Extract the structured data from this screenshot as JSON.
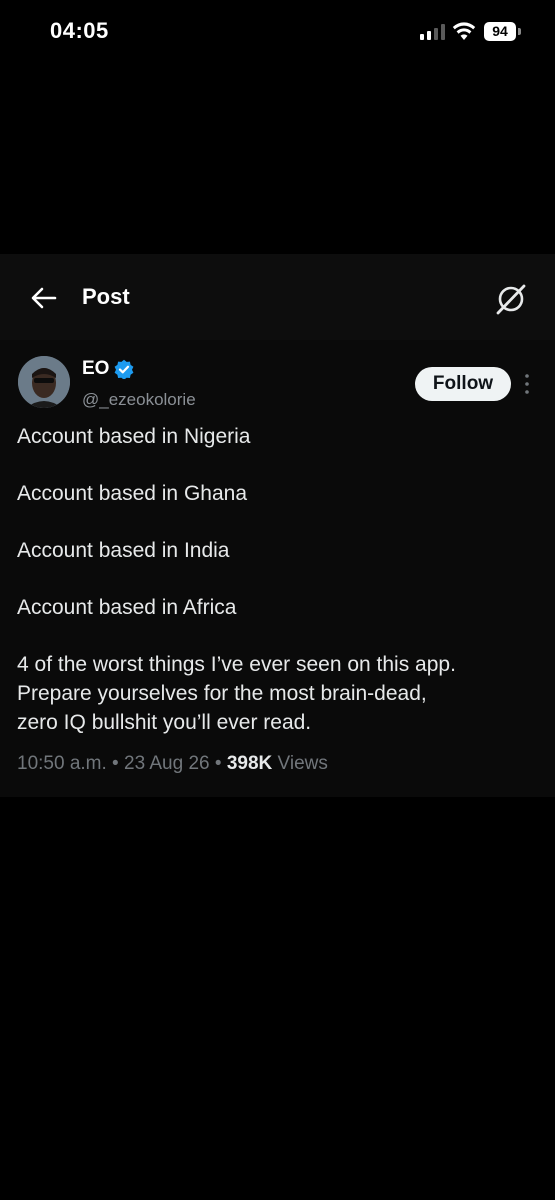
{
  "status_bar": {
    "time": "04:05",
    "battery": "94",
    "icons": [
      "signal-icon",
      "wifi-icon",
      "battery-icon"
    ]
  },
  "header": {
    "title": "Post",
    "icons": [
      "back-arrow-icon",
      "grok-icon"
    ]
  },
  "author": {
    "display_name": "EO",
    "handle": "@_ezeokolorie",
    "verified": true,
    "verified_color": "#1d9bf0"
  },
  "follow_button": {
    "label": "Follow"
  },
  "tweet": {
    "lines": [
      "Account based in Nigeria",
      "Account based in Ghana",
      "Account based in India",
      "Account based in Africa",
      "4 of the worst things I’ve ever seen on this app.",
      "Prepare yourselves for the most brain-dead,",
      "zero IQ bullshit you’ll ever read."
    ]
  },
  "meta": {
    "time": "10:50 a.m.",
    "separator": " • ",
    "date": "23 Aug 26",
    "views_count": "398K",
    "views_label": "Views"
  },
  "colors": {
    "background": "#000000",
    "panel": "#0a0a0a",
    "text_primary": "#e7e9ea",
    "text_secondary": "#71767b",
    "accent": "#1d9bf0"
  }
}
